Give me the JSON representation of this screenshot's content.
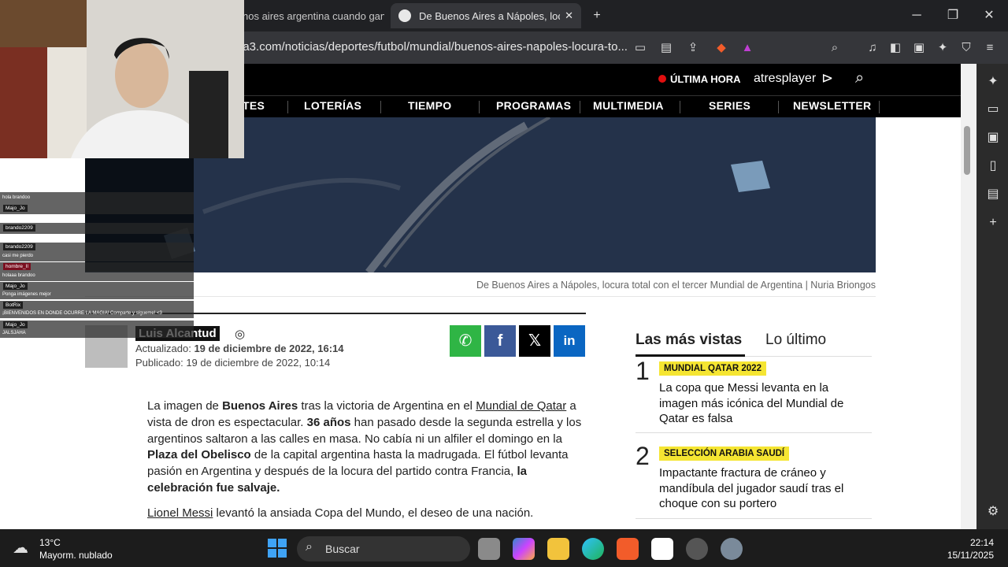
{
  "browser": {
    "tab1_title": "nos aires argentina cuando gano",
    "tab2_title": "De Buenos Aires a Nápoles, locu",
    "url": "na3.com/noticias/deportes/futbol/mundial/buenos-aires-napoles-locura-to...",
    "new_tab": "+",
    "minimize": "─",
    "maximize": "❐",
    "close": "✕"
  },
  "site": {
    "breaking": "ÚLTIMA HORA",
    "brand": "atresplayer",
    "nav": [
      "TES",
      "LOTERÍAS",
      "TIEMPO",
      "PROGRAMAS",
      "MULTIMEDIA",
      "SERIES",
      "NEWSLETTER"
    ],
    "caption": "De Buenos Aires a Nápoles, locura total con el tercer Mundial de Argentina | Nuria Briongos",
    "author": "Luis Alcantud",
    "updated_label": "Actualizado:",
    "updated_value": "19 de diciembre de 2022, 16:14",
    "published": "Publicado: 19 de diciembre de 2022, 10:14",
    "article_p2_link": "Lionel Messi",
    "article_p2_rest": " levantó la ansiada Copa del Mundo, el deseo de una nación."
  },
  "sidebar": {
    "tab_active": "Las más vistas",
    "tab_other": "Lo último",
    "items": [
      {
        "rank": "1",
        "tag": "MUNDIAL QATAR 2022",
        "title": "La copa que Messi levanta en la imagen más icónica del Mundial de Qatar es falsa"
      },
      {
        "rank": "2",
        "tag": "SELECCIÓN ARABIA SAUDÍ",
        "title": "Impactante fractura de cráneo y mandíbula del jugador saudí tras el choque con su portero"
      }
    ]
  },
  "chat": [
    {
      "text": "hola brandoo"
    },
    {
      "user": "Majo_Jo"
    },
    {
      "user": "brando2209"
    },
    {
      "user": "brando2209",
      "text": "casi me pierdo"
    },
    {
      "user": "hombre_Il",
      "text": "holaaa brandoo"
    },
    {
      "user": "Majo_Jo",
      "text": "Ponga imágenes mejor"
    },
    {
      "user": "BotRix",
      "text": "¡BIENVENIDOS EN DONDE OCURRE LA MAGIA! Comparte y sígueme! <3"
    },
    {
      "user": "Majo_Jo",
      "text": "JALSJAHA"
    }
  ],
  "taskbar": {
    "temp": "13°C",
    "weather": "Mayorm. nublado",
    "search": "Buscar",
    "time": "22:14",
    "date": "15/11/2025"
  },
  "colors": {
    "tag_yellow": "#f5e532",
    "whatsapp": "#2fb545",
    "facebook": "#3b5998",
    "x": "#000000",
    "linkedin": "#0a66c2"
  }
}
